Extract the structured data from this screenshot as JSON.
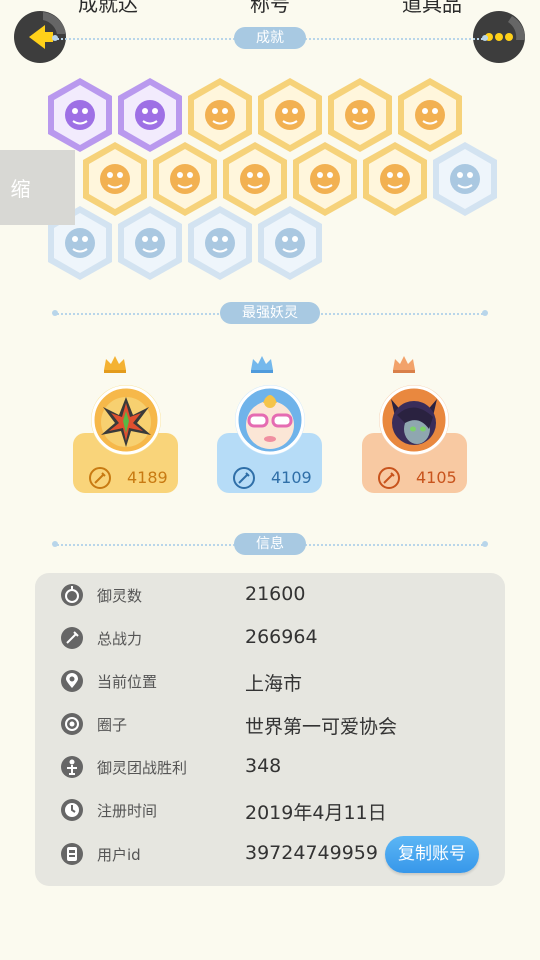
{
  "top_tabs": [
    "成就达",
    "称号",
    "道具品"
  ],
  "collapse_label": "缩",
  "sections": {
    "achievements": "成就",
    "strongest": "最强妖灵",
    "info": "信息"
  },
  "achievements": [
    {
      "icon": "purple-monster-badge",
      "style": "purple"
    },
    {
      "icon": "purple-orb-badge",
      "style": "purple"
    },
    {
      "icon": "sneaker-badge",
      "style": "gold"
    },
    {
      "icon": "sun-target-badge",
      "style": "gold"
    },
    {
      "icon": "crystal-badge",
      "style": "gold"
    },
    {
      "icon": "coin-swirl-badge",
      "style": "gold"
    },
    {
      "icon": "cart-badge",
      "style": "gold"
    },
    {
      "icon": "bear-badge",
      "style": "gold"
    },
    {
      "icon": "taiji-badge",
      "style": "gold"
    },
    {
      "icon": "dragon-badge",
      "style": "gold"
    },
    {
      "icon": "book-badge",
      "style": "gold"
    },
    {
      "icon": "moon-badge",
      "style": "blue"
    },
    {
      "icon": "ghost-badge",
      "style": "blue"
    },
    {
      "icon": "portal-badge",
      "style": "blue"
    },
    {
      "icon": "cat-badge",
      "style": "blue"
    },
    {
      "icon": "elephant-badge",
      "style": "blue"
    }
  ],
  "spirits": [
    {
      "power": "4189",
      "theme": "gold"
    },
    {
      "power": "4109",
      "theme": "blue"
    },
    {
      "power": "4105",
      "theme": "orange"
    }
  ],
  "info": {
    "rows": [
      {
        "label": "御灵数",
        "value": "21600",
        "icon": "spirit-count-icon"
      },
      {
        "label": "总战力",
        "value": "266964",
        "icon": "combat-power-icon"
      },
      {
        "label": "当前位置",
        "value": "上海市",
        "icon": "location-pin-icon"
      },
      {
        "label": "圈子",
        "value": "世界第一可爱协会",
        "icon": "circle-icon"
      },
      {
        "label": "御灵团战胜利",
        "value": "348",
        "icon": "team-battle-icon"
      },
      {
        "label": "注册时间",
        "value": "2019年4月11日",
        "icon": "clock-icon"
      },
      {
        "label": "用户id",
        "value": "39724749959",
        "icon": "id-card-icon"
      }
    ],
    "copy_button": "复制账号"
  },
  "colors": {
    "accent_blue": "#3797ea",
    "gold": "#f9d47a",
    "blue_card": "#b6dcf7",
    "orange_card": "#f8c9a2"
  }
}
